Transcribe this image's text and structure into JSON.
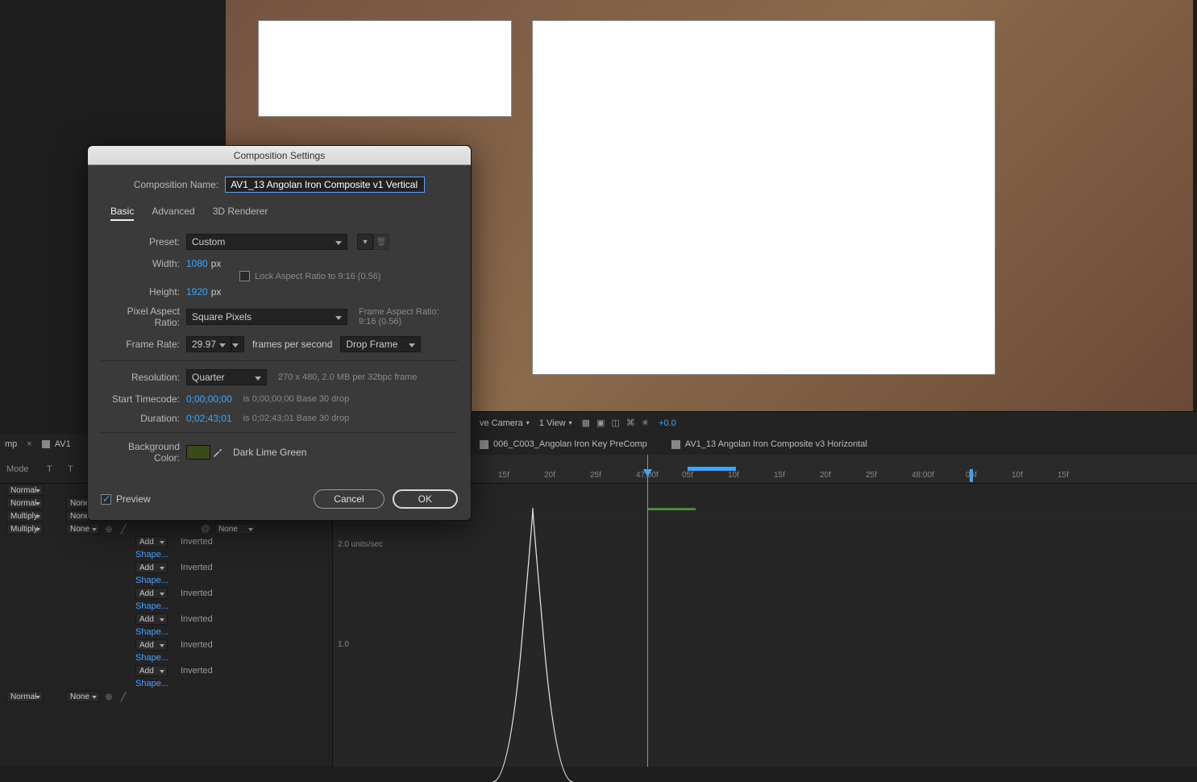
{
  "dialog": {
    "title": "Composition Settings",
    "name_label": "Composition Name:",
    "name_value": "AV1_13 Angolan Iron Composite v1 Vertical",
    "tabs": {
      "basic": "Basic",
      "advanced": "Advanced",
      "renderer": "3D Renderer"
    },
    "preset_label": "Preset:",
    "preset_value": "Custom",
    "width_label": "Width:",
    "width_value": "1080",
    "height_label": "Height:",
    "height_value": "1920",
    "px": "px",
    "lock_aspect_label": "Lock Aspect Ratio to 9:16 (0.56)",
    "par_label": "Pixel Aspect Ratio:",
    "par_value": "Square Pixels",
    "far_label": "Frame Aspect Ratio:",
    "far_value": "9:16 (0.56)",
    "fr_label": "Frame Rate:",
    "fr_value": "29.97",
    "fr_suffix": "frames per second",
    "drop_value": "Drop Frame",
    "res_label": "Resolution:",
    "res_value": "Quarter",
    "res_hint": "270 x 480, 2.0 MB per 32bpc frame",
    "start_label": "Start Timecode:",
    "start_value": "0;00;00;00",
    "start_hint": "is 0;00;00;00  Base 30  drop",
    "dur_label": "Duration:",
    "dur_value": "0;02;43;01",
    "dur_hint": "is 0;02;43;01  Base 30  drop",
    "bg_label": "Background Color:",
    "bg_name": "Dark Lime Green",
    "preview_label": "Preview",
    "cancel": "Cancel",
    "ok": "OK"
  },
  "viewer_bar": {
    "camera": "ve Camera",
    "view": "1 View",
    "exposure": "+0.0"
  },
  "comp_tabs": {
    "a": "006_C003_Angolan Iron Key PreComp",
    "b": "AV1_13 Angolan Iron Composite v3 Horizontal"
  },
  "panel_tab": {
    "left": "mp",
    "right": "AV1"
  },
  "timeline": {
    "marks": [
      "15f",
      "20f",
      "25f",
      "47;00f",
      "05f",
      "10f",
      "15f",
      "20f",
      "25f",
      "48:00f",
      "05f",
      "10f",
      "15f"
    ],
    "graph_labels": {
      "top": "2.0 units/sec",
      "mid": "1.0"
    }
  },
  "left_panel": {
    "mode_head": "Mode",
    "t_head": "T",
    "trk_head": "T",
    "mode_normal": "Normal",
    "mode_multiply": "Multiply",
    "none": "None",
    "add": "Add",
    "inverted": "Inverted",
    "shape": "Shape..."
  }
}
